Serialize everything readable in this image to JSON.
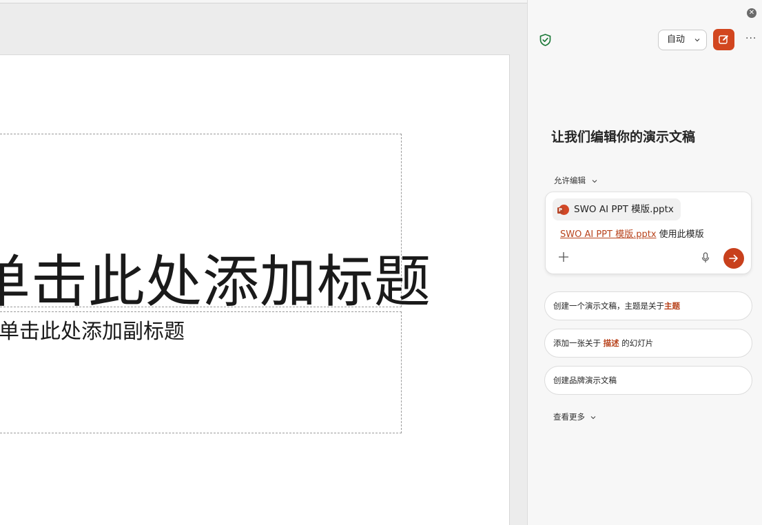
{
  "slide": {
    "title_placeholder": "单击此处添加标题",
    "subtitle_placeholder": "单击此处添加副标题"
  },
  "panel": {
    "close_icon": "close-icon",
    "shield_icon": "shield-check-icon",
    "mode_button": "自动",
    "compose_icon": "compose-icon",
    "more_icon": "more-icon",
    "more_label": "···",
    "heading": "让我们编辑你的演示文稿",
    "allow_edit": "允许编辑",
    "input": {
      "file_chip": "SWO AI PPT 模版.pptx",
      "file_link": "SWO AI PPT 模版.pptx",
      "prompt_rest": " 使用此模版",
      "plus_icon": "plus-icon",
      "mic_icon": "microphone-icon",
      "send_icon": "send-arrow-icon"
    },
    "suggestions": [
      {
        "pre": "创建一个演示文稿，主题是关于",
        "highlight": "主题",
        "post": ""
      },
      {
        "pre": "添加一张关于 ",
        "highlight": "描述",
        "post": " 的幻灯片"
      },
      {
        "pre": "创建品牌演示文稿",
        "highlight": "",
        "post": ""
      }
    ],
    "see_more": "查看更多"
  },
  "colors": {
    "accent": "#d2461f",
    "link": "#b8431c",
    "shield": "#1e7a3a"
  }
}
